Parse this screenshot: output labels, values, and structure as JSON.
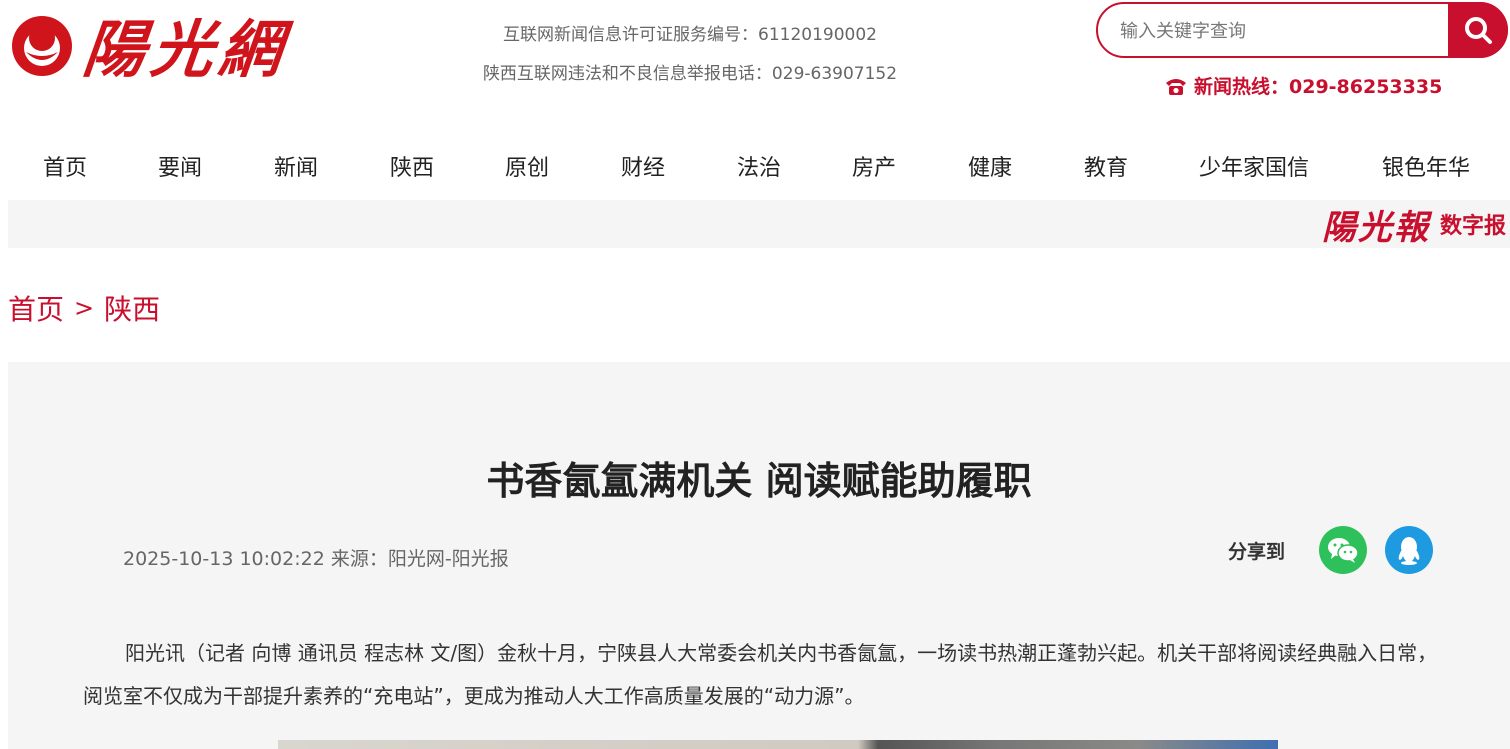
{
  "header": {
    "logo_text": "陽光網",
    "license_line1": "互联网新闻信息许可证服务编号：61120190002",
    "license_line2": "陕西互联网违法和不良信息举报电话：029-63907152",
    "search_placeholder": "输入关键字查询",
    "hotline": "新闻热线：029-86253335"
  },
  "nav": {
    "items": [
      "首页",
      "要闻",
      "新闻",
      "陕西",
      "原创",
      "财经",
      "法治",
      "房产",
      "健康",
      "教育",
      "少年家国信",
      "银色年华"
    ]
  },
  "banner": {
    "digital_logo": "陽光報",
    "digital_label": "数字报"
  },
  "breadcrumb": {
    "home": "首页",
    "separator": ">",
    "current": "陕西"
  },
  "article": {
    "title": "书香氤氲满机关 阅读赋能助履职",
    "meta": "2025-10-13 10:02:22 来源：阳光网-阳光报",
    "share_label": "分享到",
    "paragraph": "阳光讯（记者 向博 通讯员 程志林 文/图）金秋十月，宁陕县人大常委会机关内书香氤氲，一场读书热潮正蓬勃兴起。机关干部将阅读经典融入日常，阅览室不仅成为干部提升素养的“充电站”，更成为推动人大工作高质量发展的“动力源”。"
  },
  "colors": {
    "brand_red": "#c8102e",
    "wechat_green": "#2ec15b",
    "qq_blue": "#1e9ae0"
  },
  "icons": [
    "logo-mark-icon",
    "search-icon",
    "phone-icon",
    "wechat-icon",
    "qq-icon"
  ]
}
